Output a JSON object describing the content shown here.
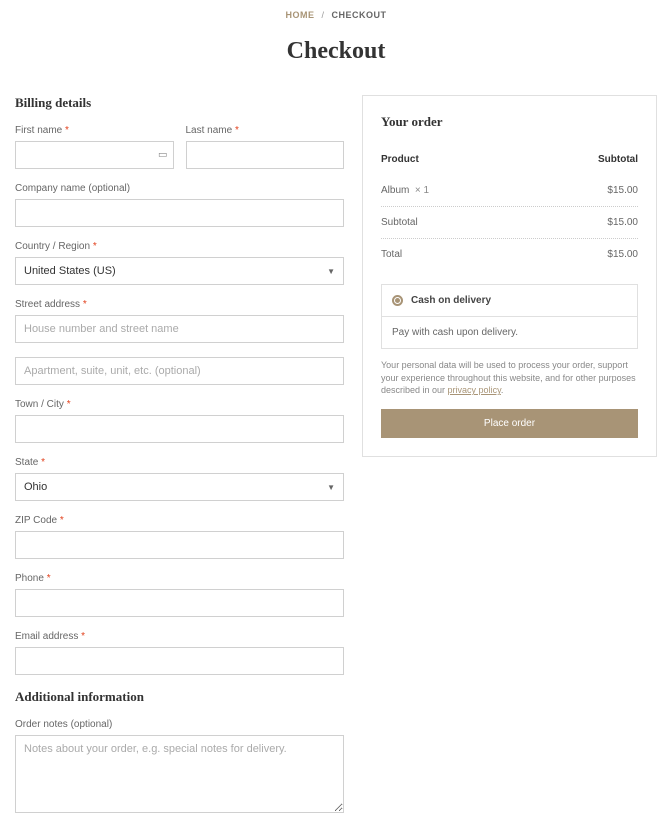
{
  "breadcrumb": {
    "home": "HOME",
    "sep": "/",
    "current": "CHECKOUT"
  },
  "page_title": "Checkout",
  "billing": {
    "heading": "Billing details",
    "first_name": "First name",
    "last_name": "Last name",
    "company": "Company name (optional)",
    "country": "Country / Region",
    "country_value": "United States (US)",
    "street": "Street address",
    "street_ph1": "House number and street name",
    "street_ph2": "Apartment, suite, unit, etc. (optional)",
    "city": "Town / City",
    "state": "State",
    "state_value": "Ohio",
    "zip": "ZIP Code",
    "phone": "Phone",
    "email": "Email address"
  },
  "additional": {
    "heading": "Additional information",
    "notes_label": "Order notes (optional)",
    "notes_ph": "Notes about your order, e.g. special notes for delivery."
  },
  "order": {
    "heading": "Your order",
    "product_h": "Product",
    "subtotal_h": "Subtotal",
    "item_name": "Album",
    "item_qty": "× 1",
    "item_price": "$15.00",
    "subtotal_label": "Subtotal",
    "subtotal_value": "$15.00",
    "total_label": "Total",
    "total_value": "$15.00"
  },
  "payment": {
    "method": "Cash on delivery",
    "desc": "Pay with cash upon delivery."
  },
  "privacy": {
    "text": "Your personal data will be used to process your order, support your experience throughout this website, and for other purposes described in our ",
    "link": "privacy policy"
  },
  "button": "Place order",
  "req": "*"
}
